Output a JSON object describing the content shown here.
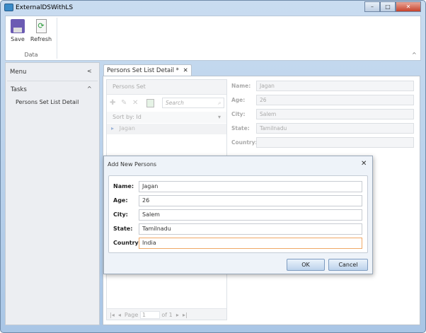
{
  "window": {
    "title": "ExternalDSWithLS",
    "minimize": "–",
    "maximize": "□",
    "close": "✕"
  },
  "ribbon": {
    "save_label": "Save",
    "refresh_label": "Refresh",
    "group_label": "Data",
    "collapse": "^"
  },
  "menu": {
    "title": "Menu",
    "collapse": "<",
    "section": "Tasks",
    "section_toggle": "^",
    "items": [
      "Persons Set List Detail"
    ]
  },
  "tab": {
    "label": "Persons Set List Detail",
    "modified": "*",
    "close": "✕"
  },
  "list": {
    "title": "Persons Set",
    "search_placeholder": "Search",
    "sort_label": "Sort by: Id",
    "rows": [
      "Jagan"
    ],
    "pager": {
      "page_label": "Page",
      "page": "1",
      "of_label": "of 1"
    }
  },
  "details": {
    "fields": [
      {
        "label": "Name:",
        "value": "Jagan"
      },
      {
        "label": "Age:",
        "value": "26"
      },
      {
        "label": "City:",
        "value": "Salem"
      },
      {
        "label": "State:",
        "value": "Tamilnadu"
      },
      {
        "label": "Country:",
        "value": ""
      }
    ]
  },
  "dialog": {
    "title": "Add New Persons",
    "close": "✕",
    "fields": [
      {
        "label": "Name:",
        "value": "Jagan"
      },
      {
        "label": "Age:",
        "value": "26"
      },
      {
        "label": "City:",
        "value": "Salem"
      },
      {
        "label": "State:",
        "value": "Tamilnadu"
      },
      {
        "label": "Country:",
        "value": "India"
      }
    ],
    "ok": "OK",
    "cancel": "Cancel"
  }
}
